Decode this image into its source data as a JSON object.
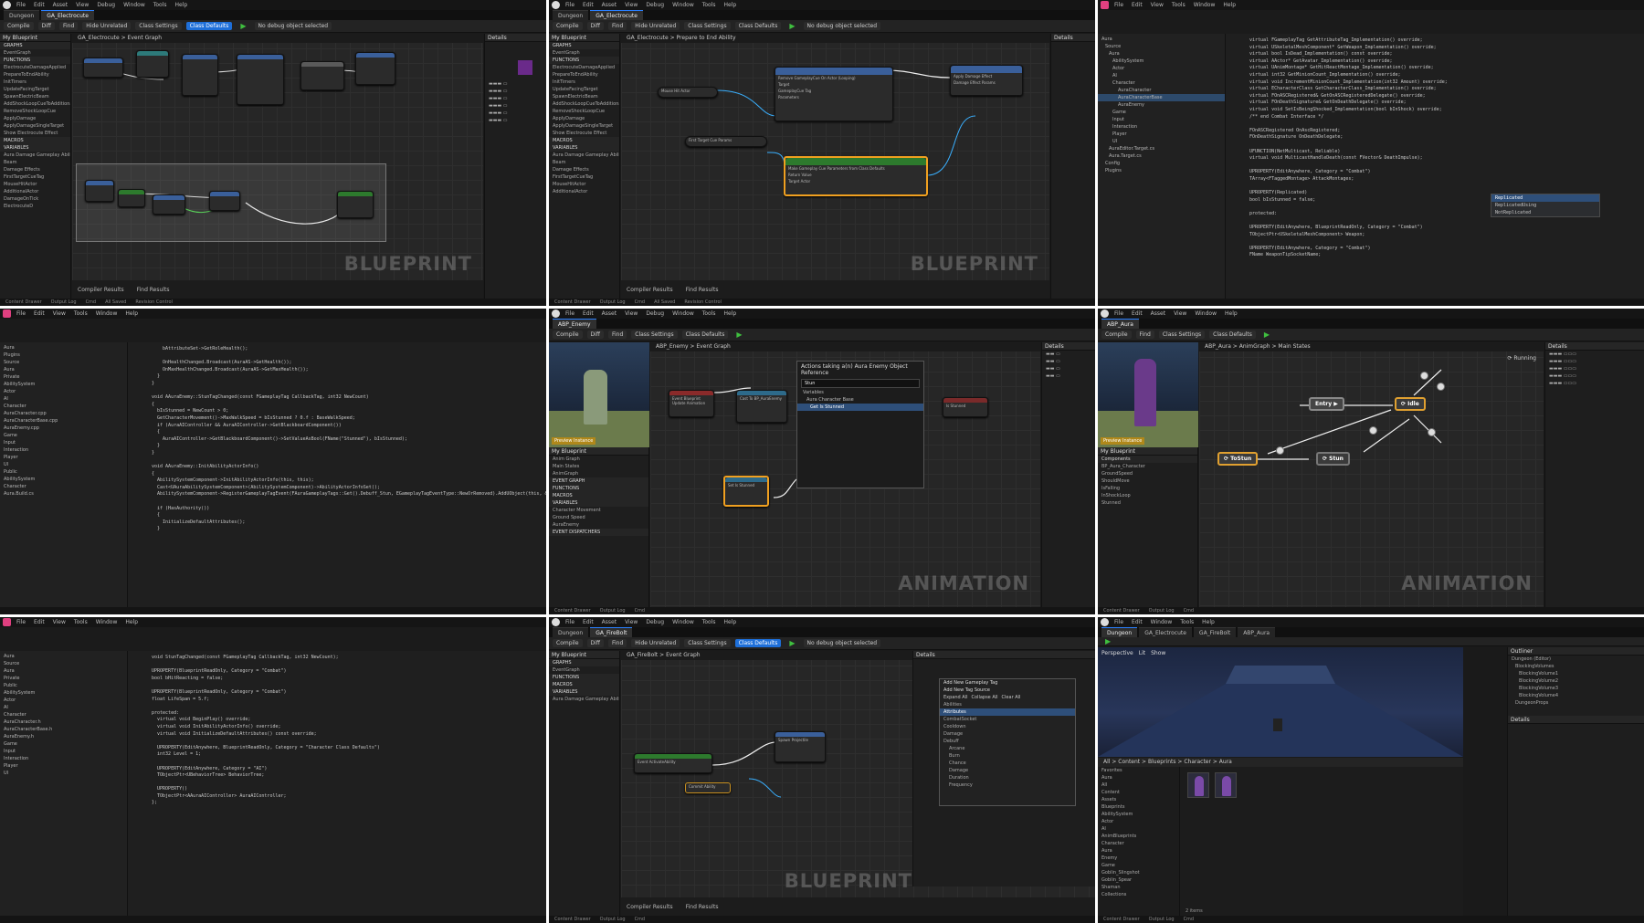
{
  "app": {
    "menu": [
      "File",
      "Edit",
      "Asset",
      "View",
      "Debug",
      "Window",
      "Tools",
      "Help"
    ],
    "toolbar": [
      "Compile",
      "Diff",
      "Find",
      "Hide Unrelated",
      "Class Settings",
      "Class Defaults",
      "No debug object selected"
    ],
    "status": [
      "Content Drawer",
      "Output Log",
      "Cmd",
      "All Saved",
      "Revision Control"
    ]
  },
  "p1": {
    "tabs": [
      "Dungeon",
      "GA_Electrocute"
    ],
    "graph_title": "GA_Electrocute > Event Graph",
    "watermark": "BLUEPRINT",
    "left_header": "My Blueprint",
    "left_items": [
      "GRAPHS",
      "EventGraph",
      "FUNCTIONS",
      "ElectrocuteDamageApplied",
      "PrepareToEndAbility",
      "InitTimers",
      "UpdateFacingTarget",
      "SpawnElectricBeam",
      "AddShockLoopCueToAdditional",
      "RemoveShockLoopCue",
      "ApplyDamage",
      "ApplyDamageSingleTarget",
      "Show Electrocute Effect",
      "MACROS",
      "VARIABLES",
      "Aura Damage Gameplay Ability",
      "Beam",
      "Damage Effects",
      "FirstTargetCueTag",
      "MouseHitActor",
      "AdditionalActor",
      "DamageOnTick",
      "ElectrocuteD"
    ],
    "right_header": "Details",
    "bottom_tabs": [
      "Compiler Results",
      "Find Results"
    ]
  },
  "p2": {
    "tabs": [
      "Dungeon",
      "GA_Electrocute"
    ],
    "graph_title": "GA_Electrocute > Prepare to End Ability",
    "watermark": "BLUEPRINT",
    "nodes": [
      "Remove GameplayCue On Actor (Looping)",
      "Apply Damage Effect",
      "Mouse Hit Actor",
      "First Target Cue Params",
      "Make Gameplay Cue Parameters from Class Defaults",
      "Target",
      "GameplayCue Tag",
      "Parameters",
      "Return Value",
      "Damage Effect Params",
      "Target Actor"
    ]
  },
  "p3": {
    "code": [
      "virtual FGameplayTag GetAttributeTag_Implementation() override;",
      "virtual USkeletalMeshComponent* GetWeapon_Implementation() override;",
      "virtual bool IsDead_Implementation() const override;",
      "virtual AActor* GetAvatar_Implementation() override;",
      "virtual UAnimMontage* GetHitReactMontage_Implementation() override;",
      "virtual int32 GetMinionCount_Implementation() override;",
      "virtual void IncrementMinionCount_Implementation(int32 Amount) override;",
      "virtual ECharacterClass GetCharacterClass_Implementation() override;",
      "virtual FOnASCRegistered& GetOnASCRegisteredDelegate() override;",
      "virtual FOnDeathSignature& GetOnDeathDelegate() override;",
      "virtual void SetIsBeingShocked_Implementation(bool bInShock) override;",
      "/** end Combat Interface */",
      "",
      "FOnASCRegistered OnAscRegistered;",
      "FOnDeathSignature OnDeathDelegate;",
      "",
      "UFUNCTION(NetMulticast, Reliable)",
      "virtual void MulticastHandleDeath(const FVector& DeathImpulse);",
      "",
      "UPROPERTY(EditAnywhere, Category = \"Combat\")",
      "TArray<FTaggedMontage> AttackMontages;",
      "",
      "UPROPERTY(Replicated)",
      "bool bIsStunned = false;",
      "",
      "protected:",
      "",
      "UPROPERTY(EditAnywhere, BlueprintReadOnly, Category = \"Combat\")",
      "TObjectPtr<USkeletalMeshComponent> Weapon;",
      "",
      "UPROPERTY(EditAnywhere, Category = \"Combat\")",
      "FName WeaponTipSocketName;"
    ],
    "autocomplete": [
      "Replicated",
      "ReplicatedUsing",
      "NotReplicated"
    ],
    "tree": [
      "Aura",
      "Source",
      "Aura",
      "AbilitySystem",
      "Actor",
      "AI",
      "Character",
      "AuraCharacter",
      "AuraCharacterBase",
      "AuraEnemy",
      "Game",
      "Input",
      "Interaction",
      "Player",
      "UI",
      "AuraEditor.Target.cs",
      "Aura.Target.cs",
      "Config",
      "Plugins"
    ]
  },
  "p4": {
    "code": [
      "    bAttributeSet->GetRoleHealth();",
      "",
      "    OnHealthChanged.Broadcast(AuraAS->GetHealth());",
      "    OnMaxHealthChanged.Broadcast(AuraAS->GetMaxHealth());",
      "  }",
      "}",
      "",
      "void AAuraEnemy::StunTagChanged(const FGameplayTag CallbackTag, int32 NewCount)",
      "{",
      "  bIsStunned = NewCount > 0;",
      "  GetCharacterMovement()->MaxWalkSpeed = bIsStunned ? 0.f : BaseWalkSpeed;",
      "  if (AuraAIController && AuraAIController->GetBlackboardComponent())",
      "  {",
      "    AuraAIController->GetBlackboardComponent()->SetValueAsBool(FName(\"Stunned\"), bIsStunned);",
      "  }",
      "}",
      "",
      "void AAuraEnemy::InitAbilityActorInfo()",
      "{",
      "  AbilitySystemComponent->InitAbilityActorInfo(this, this);",
      "  Cast<UAuraAbilitySystemComponent>(AbilitySystemComponent)->AbilityActorInfoSet();",
      "  AbilitySystemComponent->RegisterGameplayTagEvent(FAuraGameplayTags::Get().Debuff_Stun, EGameplayTagEventType::NewOrRemoved).AddUObject(this, &AAuraEnemy::StunTagChanged);",
      "",
      "  if (HasAuthority())",
      "  {",
      "    InitializeDefaultAttributes();",
      "  }"
    ],
    "tree": [
      "Aura",
      "Plugins",
      "Source",
      "Aura",
      "Private",
      "AbilitySystem",
      "Actor",
      "AI",
      "Character",
      "AuraCharacter.cpp",
      "AuraCharacterBase.cpp",
      "AuraEnemy.cpp",
      "Game",
      "Input",
      "Interaction",
      "Player",
      "UI",
      "Public",
      "AbilitySystem",
      "Character",
      "Aura.Build.cs"
    ]
  },
  "p5": {
    "tabs": [
      "ABP_Enemy"
    ],
    "graph_title": "ABP_Enemy > Event Graph",
    "watermark": "ANIMATION",
    "context_title": "Actions taking a(n) Aura Enemy Object Reference",
    "context_items": [
      "Stun",
      "Variables",
      "Aura Character Base",
      "Get Is Stunned"
    ],
    "nodes": [
      "Cast To BP_AuraEnemy",
      "Set Is Stunned",
      "Event Blueprint Update Animation",
      "Is Stunned"
    ],
    "left_items": [
      "Anim Graph",
      "Main States",
      "AnimGraph",
      "EVENT GRAPH",
      "FUNCTIONS",
      "MACROS",
      "VARIABLES",
      "Character Movement",
      "Ground Speed",
      "AuraEnemy",
      "EVENT DISPATCHERS"
    ],
    "viewport_badge": "Preview Instance"
  },
  "p6": {
    "tabs": [
      "ABP_Aura"
    ],
    "graph_title": "ABP_Aura > AnimGraph > Main States",
    "watermark": "ANIMATION",
    "states": [
      "Idle",
      "ToStun",
      "Stun",
      "Entry"
    ],
    "left_items": [
      "Components",
      "BP_Aura_Character",
      "GroundSpeed",
      "ShouldMove",
      "IsFalling",
      "InShockLoop",
      "Stunned"
    ],
    "running_label": "Running"
  },
  "p7": {
    "code": [
      "void StunTagChanged(const FGameplayTag CallbackTag, int32 NewCount);",
      "",
      "UPROPERTY(BlueprintReadOnly, Category = \"Combat\")",
      "bool bHitReacting = false;",
      "",
      "UPROPERTY(BlueprintReadOnly, Category = \"Combat\")",
      "float LifeSpan = 5.f;",
      "",
      "protected:",
      "  virtual void BeginPlay() override;",
      "  virtual void InitAbilityActorInfo() override;",
      "  virtual void InitializeDefaultAttributes() const override;",
      "",
      "  UPROPERTY(EditAnywhere, BlueprintReadOnly, Category = \"Character Class Defaults\")",
      "  int32 Level = 1;",
      "",
      "  UPROPERTY(EditAnywhere, Category = \"AI\")",
      "  TObjectPtr<UBehaviorTree> BehaviorTree;",
      "",
      "  UPROPERTY()",
      "  TObjectPtr<AAuraAIController> AuraAIController;",
      "};"
    ],
    "tree": [
      "Aura",
      "Source",
      "Aura",
      "Private",
      "Public",
      "AbilitySystem",
      "Actor",
      "AI",
      "Character",
      "AuraCharacter.h",
      "AuraCharacterBase.h",
      "AuraEnemy.h",
      "Game",
      "Input",
      "Interaction",
      "Player",
      "UI"
    ]
  },
  "p8": {
    "tabs": [
      "Dungeon",
      "GA_FireBolt"
    ],
    "graph_title": "GA_FireBolt > Event Graph",
    "watermark": "BLUEPRINT",
    "tag_menu": [
      "Add New Gameplay Tag",
      "Add New Tag Source",
      "Expand All",
      "Collapse All",
      "Clear All",
      "Abilities",
      "Attributes",
      "CombatSocket",
      "Cooldown",
      "Damage",
      "Debuff",
      "Arcane",
      "Burn",
      "Chance",
      "Damage",
      "Duration",
      "Frequency"
    ],
    "nodes": [
      "Event ActivateAbility",
      "Commit Ability",
      "Spawn Projectile"
    ]
  },
  "p9": {
    "tabs": [
      "Dungeon",
      "GA_Electrocute",
      "GA_FireBolt",
      "ABP_Aura"
    ],
    "perspective": "Perspective",
    "lit": "Lit",
    "show": "Show",
    "outliner_header": "Outliner",
    "outliner_items": [
      "Dungeon (Editor)",
      "BlockingVolumes",
      "BlockingVolume1",
      "BlockingVolume2",
      "BlockingVolume3",
      "BlockingVolume4",
      "DungeonProps"
    ],
    "content_path": "All > Content > Blueprints > Character > Aura",
    "content_tree": [
      "Favorites",
      "Aura",
      "All",
      "Content",
      "Assets",
      "Blueprints",
      "AbilitySystem",
      "Actor",
      "AI",
      "AnimBlueprints",
      "Character",
      "Aura",
      "Enemy",
      "Game",
      "Goblin_Slingshot",
      "Goblin_Spear",
      "Shaman",
      "Collections"
    ],
    "count": "2 items"
  }
}
